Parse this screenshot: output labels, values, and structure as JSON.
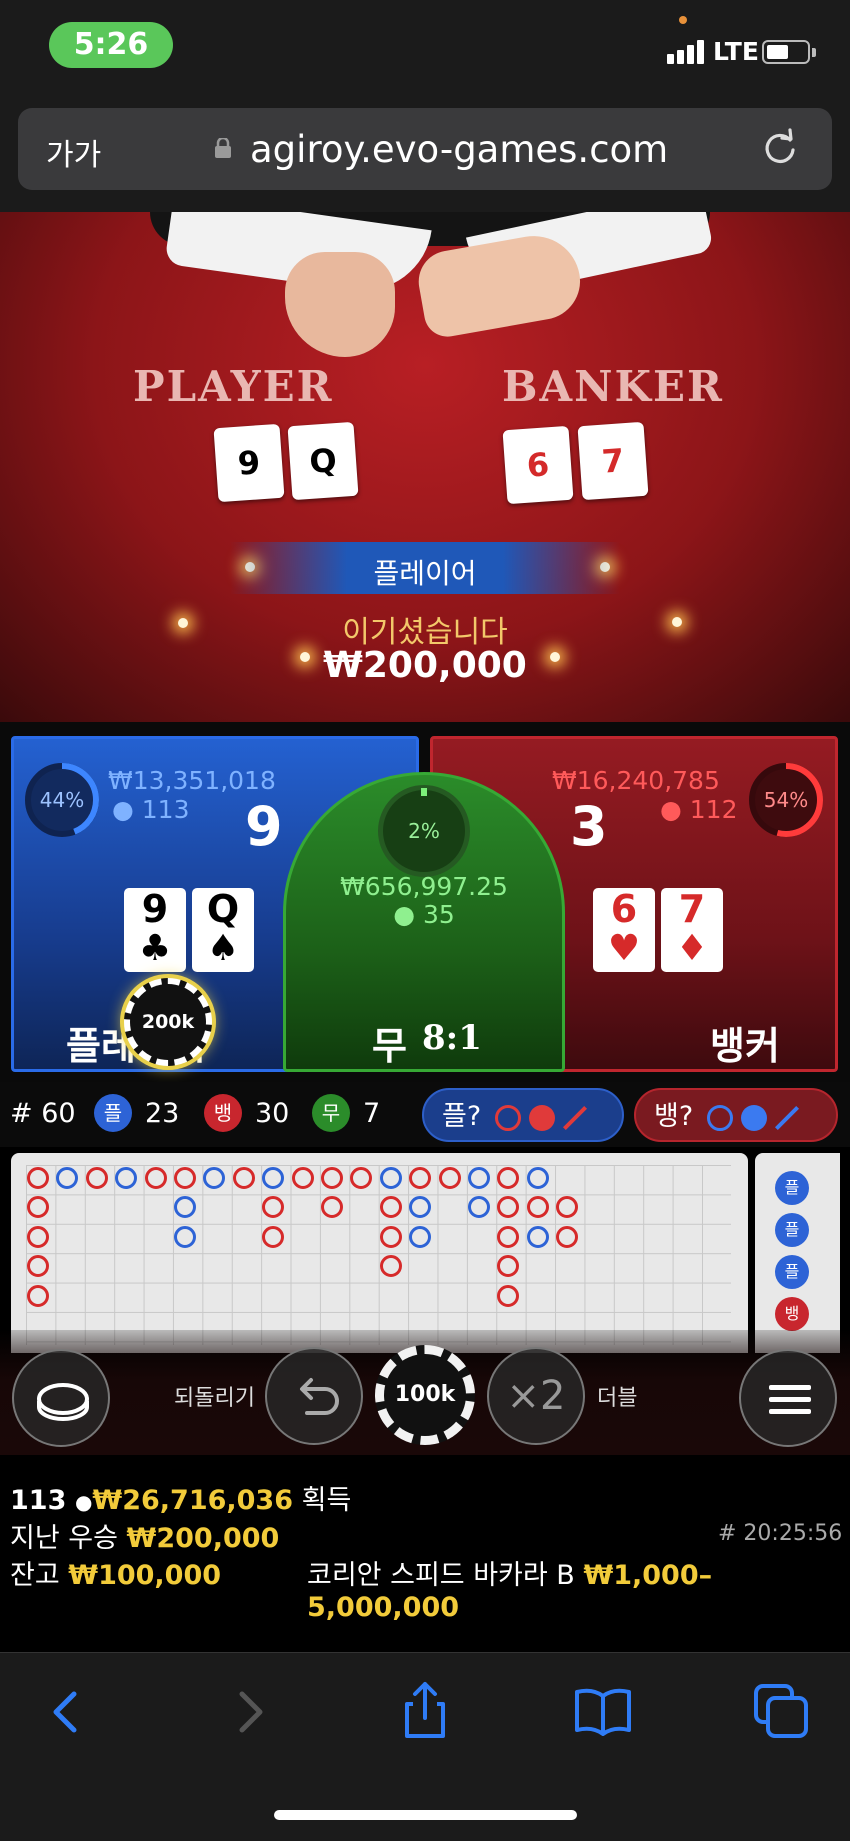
{
  "status_bar": {
    "time": "5:26",
    "network": "LTE"
  },
  "browser": {
    "reader_label": "가가",
    "url": "agiroy.evo-games.com"
  },
  "table": {
    "player_label": "PLAYER",
    "banker_label": "BANKER",
    "player_cards": [
      {
        "rank": "9",
        "suit": "♣",
        "red": false
      },
      {
        "rank": "Q",
        "suit": "♠",
        "red": false
      }
    ],
    "banker_cards": [
      {
        "rank": "6",
        "suit": "♥",
        "red": true
      },
      {
        "rank": "7",
        "suit": "♦",
        "red": true
      }
    ]
  },
  "result": {
    "winner": "플레이어",
    "message": "이기셨습니다",
    "amount": "₩200,000"
  },
  "bets": {
    "player": {
      "pct": "44%",
      "pct_value": 44,
      "amount": "₩13,351,018",
      "players": "113",
      "score": "9",
      "label": "플레이어",
      "chip": "200k"
    },
    "tie": {
      "pct": "2%",
      "pct_value": 2,
      "amount": "₩656,997.25",
      "players": "35",
      "label": "무",
      "odds": "8:1"
    },
    "banker": {
      "pct": "54%",
      "pct_value": 54,
      "amount": "₩16,240,785",
      "players": "112",
      "score": "3",
      "label": "뱅커"
    }
  },
  "stats": {
    "rounds": "# 60",
    "player_badge": "플",
    "player_count": "23",
    "banker_badge": "뱅",
    "banker_count": "30",
    "tie_badge": "무",
    "tie_count": "7",
    "player_predict": "플?",
    "banker_predict": "뱅?"
  },
  "roadmap_side": [
    "플",
    "플",
    "플",
    "뱅"
  ],
  "controls": {
    "undo_label": "되돌리기",
    "chip_value": "100k",
    "double_symbol": "×2",
    "double_label": "더블"
  },
  "info": {
    "players_online": "113",
    "total_won": "₩26,716,036",
    "won_label": "획득",
    "last_win_label": "지난 우승",
    "last_win_amount": "₩200,000",
    "game_id": "# 20:25:56",
    "balance_label": "잔고",
    "balance": "₩100,000",
    "table_name": "코리안 스피드 바카라 B",
    "limits": "₩1,000–5,000,000"
  },
  "colors": {
    "player": "#2461d1",
    "banker": "#951b22",
    "tie": "#2b8c2a",
    "gold": "#f2cb3a"
  }
}
